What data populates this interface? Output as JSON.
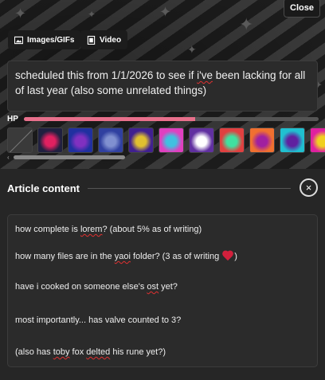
{
  "header": {
    "close_label": "Close"
  },
  "media": {
    "images_label": "Images/GIFs",
    "video_label": "Video"
  },
  "title_text": {
    "before": "scheduled this from 1/1/2026 to see if ",
    "flagged": "i've",
    "after": " been lacking for all of last year (also some unrelated things)"
  },
  "hp": {
    "label": "HP",
    "fraction": 0.58
  },
  "thumbnails": [
    {
      "name": "empty-slot",
      "colors": [
        "#3a3a3a",
        "#3a3a3a"
      ]
    },
    {
      "name": "glitch-noise",
      "colors": [
        "#202040",
        "#e02060"
      ]
    },
    {
      "name": "blue-purple-blob",
      "colors": [
        "#2030a0",
        "#8030c0"
      ]
    },
    {
      "name": "blue-grid",
      "colors": [
        "#3040a0",
        "#8090d0"
      ]
    },
    {
      "name": "purple-cube",
      "colors": [
        "#402090",
        "#e0c030"
      ]
    },
    {
      "name": "pink-heart",
      "colors": [
        "#e040c0",
        "#40c0e0"
      ]
    },
    {
      "name": "purple-hand",
      "colors": [
        "#6030a0",
        "#ffffff"
      ]
    },
    {
      "name": "rainbow-stripes",
      "colors": [
        "#e04040",
        "#40e0a0"
      ]
    },
    {
      "name": "orange-heart",
      "colors": [
        "#f07030",
        "#a020a0"
      ]
    },
    {
      "name": "cyan-heart",
      "colors": [
        "#20c0d0",
        "#6020a0"
      ]
    },
    {
      "name": "yellow-magenta-heart",
      "colors": [
        "#e020a0",
        "#f0d020"
      ]
    }
  ],
  "article": {
    "title": "Article content",
    "close_glyph": "×",
    "line1": {
      "before": "how complete is ",
      "flagged": "lorem",
      "after": "? (about 5% as of writing)"
    },
    "line2": {
      "before": "how many files are in the ",
      "flagged": "yaoi",
      "after": " folder? (3 as of writing ",
      "end": ")"
    },
    "line3": {
      "before": "have i cooked on someone else's ",
      "flagged": "ost",
      "after": " yet?"
    },
    "line4": {
      "text": "most importantly... has valve counted to 3?"
    },
    "line5": {
      "before": "(also has ",
      "flagged1": "toby",
      "mid": " fox ",
      "flagged2": "delted",
      "after": " his rune yet?)"
    }
  },
  "colors": {
    "hp_fill": "#e8708c",
    "spell_error": "#e03030"
  }
}
